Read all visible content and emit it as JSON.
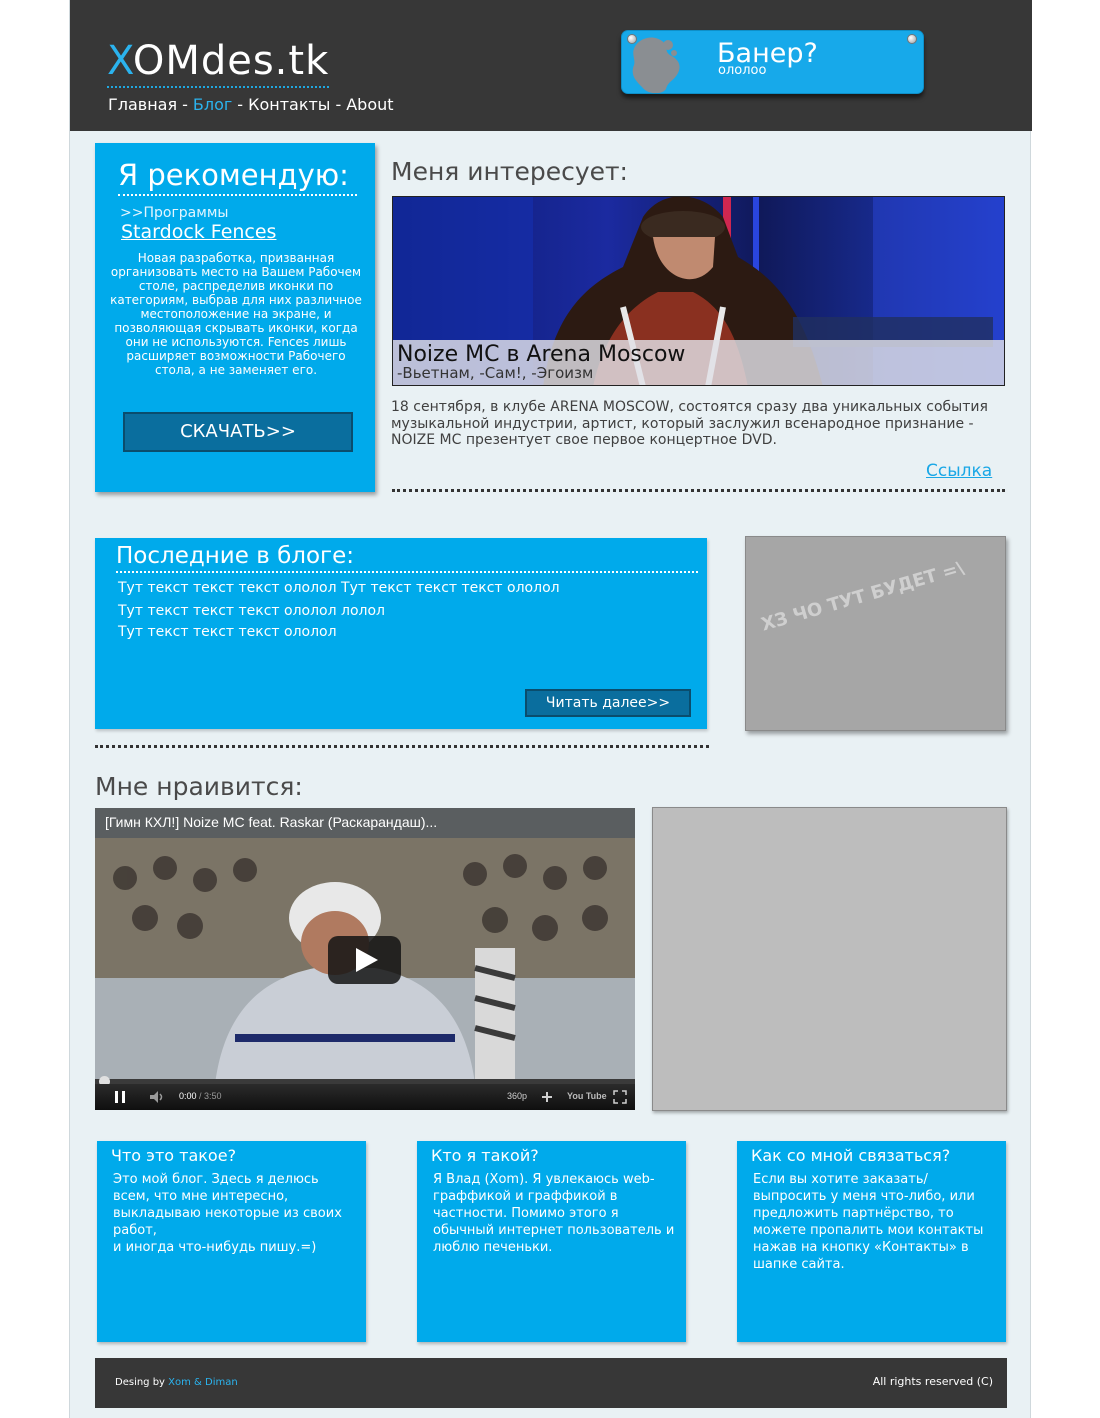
{
  "header": {
    "logo_first": "X",
    "logo_rest": "OMdes.tk",
    "nav": [
      {
        "label": "Главная",
        "active": false
      },
      {
        "label": "Блог",
        "active": true
      },
      {
        "label": "Контакты",
        "active": false
      },
      {
        "label": "About",
        "active": false
      }
    ],
    "nav_sep": "-",
    "banner": {
      "title": "Банер?",
      "subtitle": "ололоо"
    }
  },
  "recommend": {
    "title": "Я рекомендую:",
    "category": ">>Программы",
    "program": "Stardock Fences",
    "description": "Новая разработка, призванная организовать место на Вашем Рабочем столе, распределив иконки по категориям, выбрав для них различное местоположение на экране, и позволяющая скрывать иконки, когда они не используются. Fences лишь расширяет возможности Рабочего стола, а не заменяет его.",
    "button": "СКАЧАТЬ>>"
  },
  "interest": {
    "title": "Меня интересует:",
    "caption_title_bold": "Noize MC",
    "caption_title_rest": " в Arena Moscow",
    "caption_sub": "-Вьетнам, -Сам!, -Эгоизм",
    "text": "18 сентября, в клубе ARENA MOSCOW, состоятся сразу два уникальных события музыкальной индустрии, артист, который заслужил всенародное признание - NOIZE MC презентует свое первое концертное DVD.",
    "link": "Ссылка"
  },
  "blog": {
    "title": "Последние в блоге:",
    "posts": [
      "Тут текст текст текст ололол Тут текст текст текст ололол",
      "Тут текст текст текст ололол лолол",
      "Тут текст текст текст ололол"
    ],
    "button": "Читать далее>>"
  },
  "placeholder_box": {
    "text": "ХЗ ЧО ТУТ БУДЕТ =\\"
  },
  "like": {
    "title": "Мне нраивится:",
    "video": {
      "title": "[Гимн КХЛ!] Noize MC feat. Raskar (Раскарандаш)...",
      "time_current": "0:00",
      "time_total": " / 3:50",
      "quality": "360p",
      "logo": "You Tube"
    }
  },
  "info": [
    {
      "title": "Что это такое?",
      "body": "Это мой блог. Здесь я делюсь всем, что мне интересно, выкладываю некоторые из своих работ,\nи иногда что-нибудь пишу.=)"
    },
    {
      "title": "Кто я такой?",
      "body": "Я Влад (Xom). Я увлекаюсь web-граффикой и граффикой в частности. Помимо этого я обычный интернет пользователь и люблю печеньки."
    },
    {
      "title": "Как со мной связаться?",
      "body": "Если вы хотите заказать/выпросить у меня что-либо, или предложить партнёрство, то можете пропалить мои контакты нажав на кнопку «Контакты» в шапке сайта."
    }
  ],
  "footer": {
    "design_label": "Desing by",
    "design_names": "Xom & Diman",
    "rights": "All rights reserved (C)"
  },
  "colors": {
    "accent": "#00aaeb",
    "header_bg": "#373737",
    "page_bg": "#e9f1f4"
  }
}
